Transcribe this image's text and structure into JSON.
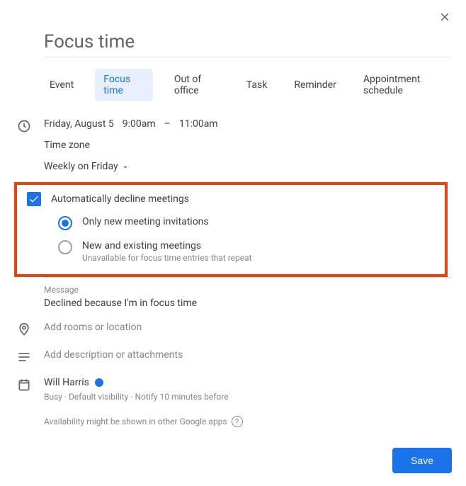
{
  "title": "Focus time",
  "tabs": [
    "Event",
    "Focus time",
    "Out of office",
    "Task",
    "Reminder",
    "Appointment schedule"
  ],
  "activeTab": "Focus time",
  "date": "Friday, August 5",
  "startTime": "9:00am",
  "dash": "–",
  "endTime": "11:00am",
  "timezone": "Time zone",
  "recurrence": "Weekly on Friday",
  "autoDecline": {
    "checked": true,
    "label": "Automatically decline meetings",
    "options": [
      {
        "label": "Only new meeting invitations",
        "selected": true
      },
      {
        "label": "New and existing meetings",
        "sublabel": "Unavailable for focus time entries that repeat",
        "selected": false
      }
    ]
  },
  "message": {
    "label": "Message",
    "value": "Declined because I'm in focus time"
  },
  "locationPlaceholder": "Add rooms or location",
  "descriptionPlaceholder": "Add description or attachments",
  "calendar": {
    "owner": "Will Harris",
    "color": "#1a73e8",
    "sub": "Busy · Default visibility · Notify 10 minutes before"
  },
  "availabilityNote": "Availability might be shown in other Google apps",
  "saveLabel": "Save"
}
